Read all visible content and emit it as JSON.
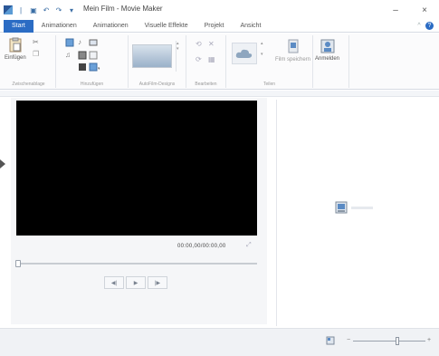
{
  "window": {
    "title": "Mein Film - Movie Maker",
    "minimize_label": "–",
    "close_label": "×"
  },
  "ribbon_tabs": [
    {
      "label": "Start",
      "active": true
    },
    {
      "label": "Animationen"
    },
    {
      "label": "Animationen"
    },
    {
      "label": "Visuelle Effekte"
    },
    {
      "label": "Projekt"
    },
    {
      "label": "Ansicht"
    }
  ],
  "ribbon_groups": {
    "clipboard_label": "Zwischenablage",
    "add_label": "Hinzufügen",
    "autofilm_label": "AutoFilm-Designs",
    "edit_label": "Bearbeiten",
    "share_label": "Teilen",
    "paste_button": "Einfügen",
    "save_movie_button": "Film speichern",
    "signin_button": "Anmelden"
  },
  "player": {
    "timecode": "00:00,00/00:00,00",
    "prev_label": "◀|",
    "play_label": "▶",
    "next_label": "|▶"
  },
  "colors": {
    "accent": "#2b6cc4",
    "video_bg": "#000000"
  }
}
